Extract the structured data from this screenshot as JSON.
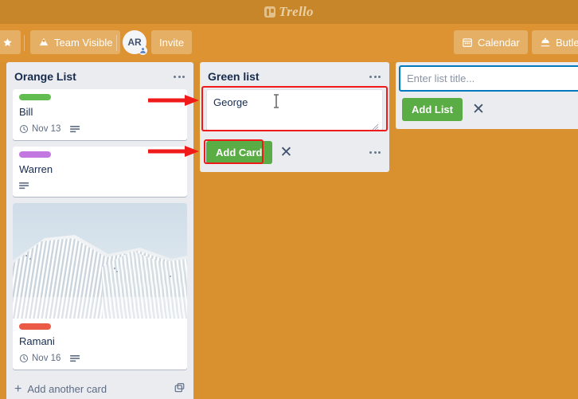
{
  "brand": {
    "name": "Trello",
    "logo_icon": "trello-logo-icon"
  },
  "header": {
    "team_visible": {
      "label": "Team Visible",
      "icon": "team-visible-icon"
    },
    "invite": {
      "label": "Invite"
    },
    "avatar": {
      "initials": "AR"
    },
    "calendar": {
      "label": "Calendar",
      "icon": "calendar-icon"
    },
    "butler": {
      "label": "Butler",
      "icon": "butler-icon"
    }
  },
  "lists": [
    {
      "title": "Orange List",
      "menu_icon": "list-menu-icon",
      "cards": [
        {
          "title": "Bill",
          "label_color": "#61bd4f",
          "due": "Nov 13",
          "clock_icon": "clock-icon",
          "description_icon": "description-icon"
        },
        {
          "title": "Warren",
          "label_color": "#c377e0",
          "due": "",
          "description_icon": "description-icon"
        },
        {
          "title": "Ramani",
          "label_color": "#eb5a46",
          "due": "Nov 16",
          "clock_icon": "clock-icon",
          "description_icon": "description-icon",
          "has_cover": true
        }
      ],
      "footer": {
        "add_card_label": "Add another card",
        "plus_icon": "plus-icon",
        "template_icon": "card-template-icon"
      }
    },
    {
      "title": "Green list",
      "menu_icon": "list-menu-icon",
      "composer": {
        "value": "George",
        "placeholder": "",
        "add_card_label": "Add Card",
        "close_icon": "close-icon",
        "options_icon": "composer-options-icon",
        "resize_grip_icon": "resize-grip-icon"
      }
    }
  ],
  "add_list": {
    "placeholder": "Enter list title...",
    "value": "",
    "add_list_label": "Add List",
    "close_icon": "close-icon"
  },
  "cursor": {
    "type": "i-beam"
  },
  "annotations": {
    "arrow_color": "#f01a1a",
    "highlight_color": "#f01a1a",
    "arrows": [
      {
        "target": "card-composer-textarea"
      },
      {
        "target": "add-card-button"
      }
    ]
  },
  "colors": {
    "board_background": "#dd9331",
    "brand_bar": "#c8862a",
    "list_background": "#ebecf0",
    "primary_button": "#5aac44",
    "input_focus_border": "#0079bf"
  }
}
